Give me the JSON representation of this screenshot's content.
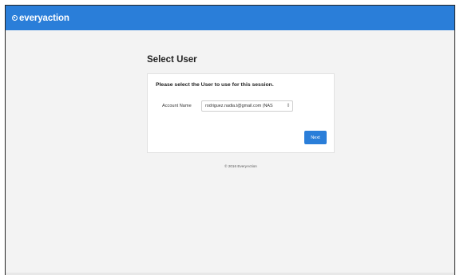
{
  "brand": {
    "name": "everyaction",
    "logo_icon": "everyaction-logo-icon"
  },
  "colors": {
    "header_bg": "#2a7ed9",
    "page_bg": "#f3f3f3",
    "button_bg": "#2a7ed9"
  },
  "page": {
    "title": "Select User"
  },
  "card": {
    "heading": "Please select the User to use for this session.",
    "account_label": "Account Name",
    "account_value": "rodriguez.nadia.t@gmail.com (NAS",
    "chevron_icon": "updown-chevron-icon",
    "next_label": "Next"
  },
  "footer": {
    "text": "© 2016 EveryAction"
  }
}
